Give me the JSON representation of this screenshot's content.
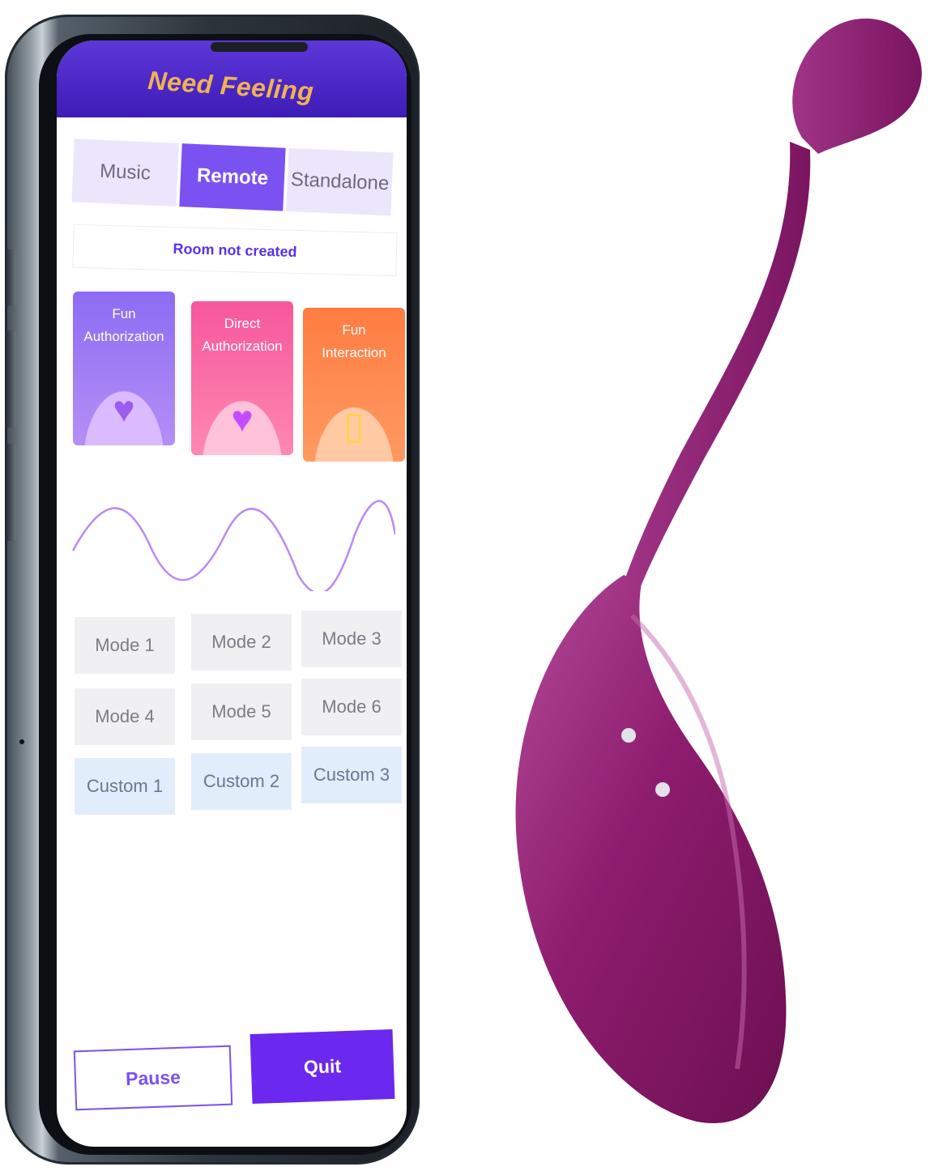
{
  "app": {
    "title": "Need Feeling"
  },
  "tabs": [
    {
      "label": "Music",
      "active": false
    },
    {
      "label": "Remote",
      "active": true
    },
    {
      "label": "Standalone",
      "active": false
    }
  ],
  "room_status": "Room not created",
  "cards": [
    {
      "line1": "Fun",
      "line2": "Authorization",
      "icon": "heart-icon"
    },
    {
      "line1": "Direct",
      "line2": "Authorization",
      "icon": "crystal-ball-heart-icon"
    },
    {
      "line1": "Fun",
      "line2": "Interaction",
      "icon": "phone-heart-icon"
    }
  ],
  "modes": [
    "Mode 1",
    "Mode 2",
    "Mode 3",
    "Mode 4",
    "Mode 5",
    "Mode 6"
  ],
  "customs": [
    "Custom 1",
    "Custom 2",
    "Custom 3"
  ],
  "buttons": {
    "pause": "Pause",
    "quit": "Quit"
  },
  "colors": {
    "accent": "#7a52f1",
    "header": "#4a26c4",
    "title": "#f0b352",
    "product": "#8e1c6e"
  }
}
